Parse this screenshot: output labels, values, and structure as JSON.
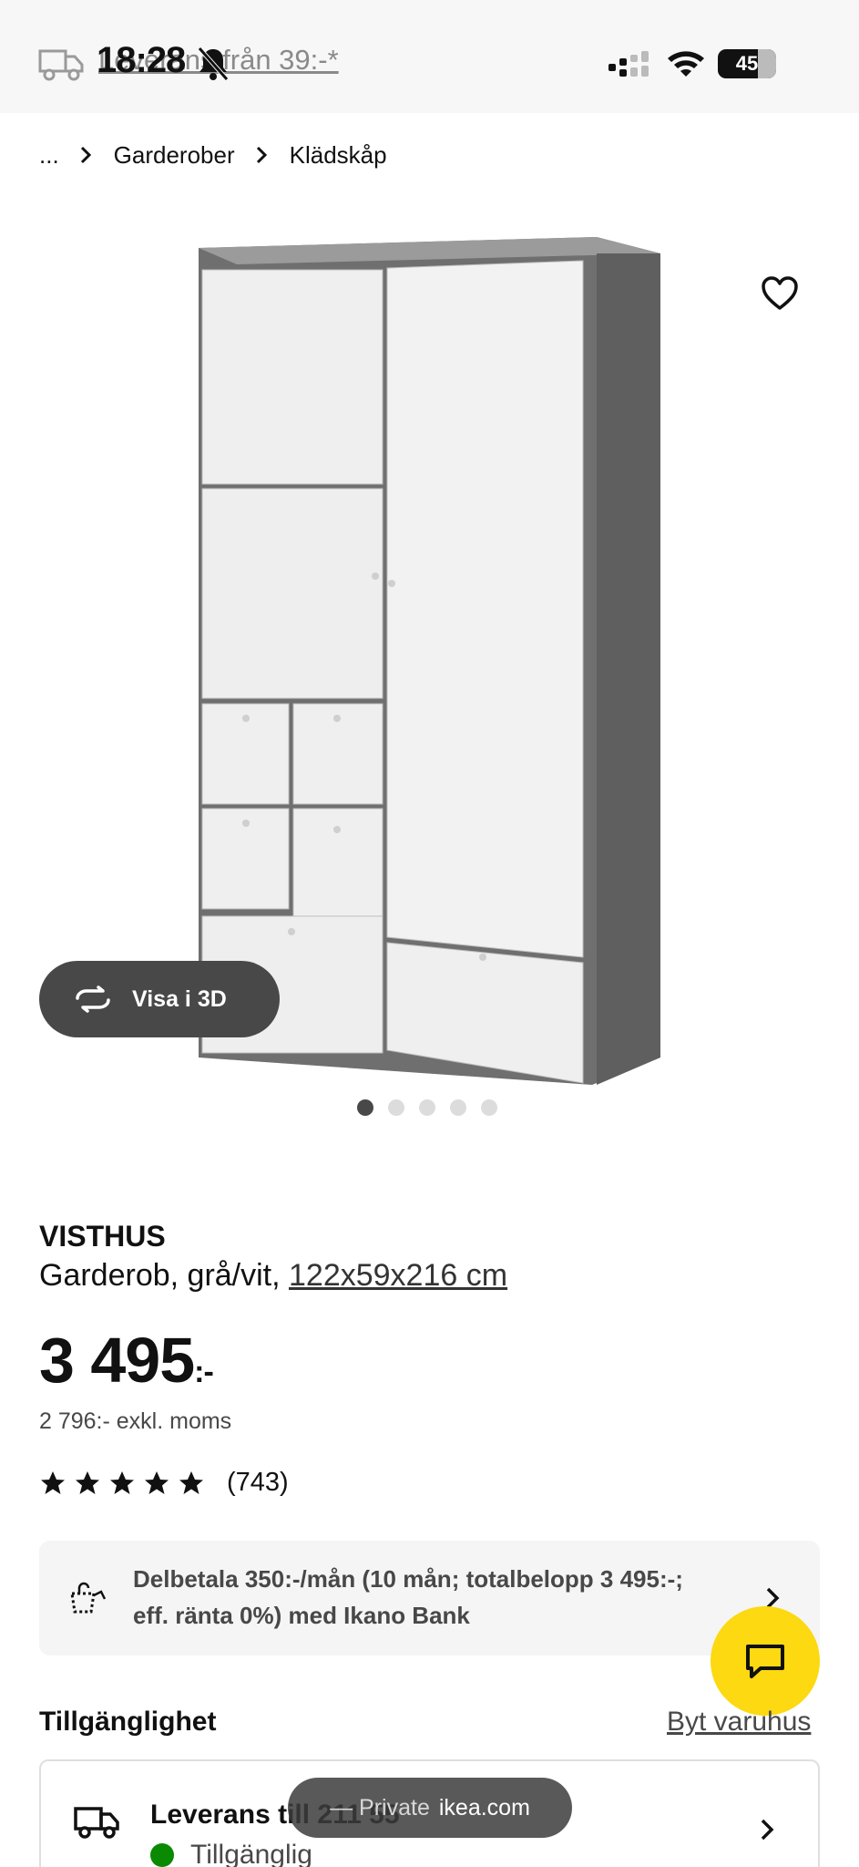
{
  "status_bar": {
    "time": "18:28",
    "promo_text": "Leverans från 39:-*",
    "battery": "45"
  },
  "breadcrumb": {
    "ellipsis": "...",
    "items": [
      "Garderober",
      "Klädskåp"
    ]
  },
  "gallery": {
    "view_3d_label": "Visa i 3D",
    "image_count": 5,
    "active_index": 0
  },
  "product": {
    "name": "VISTHUS",
    "description": "Garderob, grå/vit, ",
    "dimensions": "122x59x216 cm",
    "price": "3 495",
    "price_suffix": ":-",
    "price_excl_vat": "2 796:- exkl. moms",
    "rating_stars": 5,
    "review_count": "(743)"
  },
  "installment": {
    "text": "Delbetala 350:-/mån (10 mån; totalbelopp 3 495:-; eff. ränta 0%) med Ikano Bank"
  },
  "availability": {
    "title": "Tillgänglighet",
    "change_store": "Byt varuhus",
    "delivery_title": "Leverans till 211 55",
    "delivery_status": "Tillgänglig"
  },
  "browser": {
    "mode": "— Private",
    "domain": "ikea.com"
  },
  "colors": {
    "accent_yellow": "#fcd910",
    "available_green": "#0a8a00",
    "dark_button": "#484848"
  }
}
